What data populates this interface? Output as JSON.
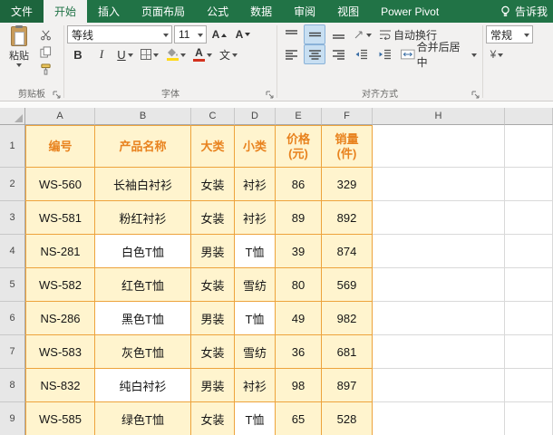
{
  "colors": {
    "ribbon_green": "#217346",
    "ribbon_bg": "#F2F1F0",
    "header_bg": "#E7E7E7",
    "gridline": "#D9D9D9",
    "cell_fill": "#FFF4CE",
    "table_border": "#EDA33C",
    "table_header_text": "#E8821E",
    "fill_swatch": "#FFD919",
    "font_color_swatch": "#D3321E"
  },
  "ribbon": {
    "tabs": [
      "文件",
      "开始",
      "插入",
      "页面布局",
      "公式",
      "数据",
      "审阅",
      "视图",
      "Power Pivot"
    ],
    "active_tab": "开始",
    "tell_me": "告诉我",
    "clipboard": {
      "label": "剪贴板",
      "paste": "粘贴"
    },
    "font": {
      "label": "字体",
      "name": "等线",
      "size": "11",
      "bold": "B",
      "italic": "I",
      "underline": "U",
      "grow": "A",
      "shrink": "A",
      "color_letter": "A",
      "pinyin": "文"
    },
    "alignment": {
      "label": "对齐方式",
      "wrap_text": "自动换行",
      "merge_center": "合并后居中"
    },
    "number": {
      "format": "常规",
      "accounting": "¥"
    }
  },
  "sheet": {
    "column_letters": [
      "A",
      "B",
      "C",
      "D",
      "E",
      "F",
      "H"
    ],
    "row_numbers": [
      "1",
      "2",
      "3",
      "4",
      "5",
      "6",
      "7",
      "8",
      "9"
    ],
    "table": {
      "headers": [
        "编号",
        "产品名称",
        "大类",
        "小类",
        "价格(元)",
        "销量(件)"
      ],
      "rows": [
        [
          "WS-560",
          "长袖白衬衫",
          "女装",
          "衬衫",
          "86",
          "329"
        ],
        [
          "WS-581",
          "粉红衬衫",
          "女装",
          "衬衫",
          "89",
          "892"
        ],
        [
          "NS-281",
          "白色T恤",
          "男装",
          "T恤",
          "39",
          "874"
        ],
        [
          "WS-582",
          "红色T恤",
          "女装",
          "雪纺",
          "80",
          "569"
        ],
        [
          "NS-286",
          "黑色T恤",
          "男装",
          "T恤",
          "49",
          "982"
        ],
        [
          "WS-583",
          "灰色T恤",
          "女装",
          "雪纺",
          "36",
          "681"
        ],
        [
          "NS-832",
          "纯白衬衫",
          "男装",
          "衬衫",
          "98",
          "897"
        ],
        [
          "WS-585",
          "绿色T恤",
          "女装",
          "T恤",
          "65",
          "528"
        ]
      ],
      "white_cells": [
        "B4",
        "D4",
        "B6",
        "D6",
        "B8",
        "D9"
      ]
    }
  }
}
